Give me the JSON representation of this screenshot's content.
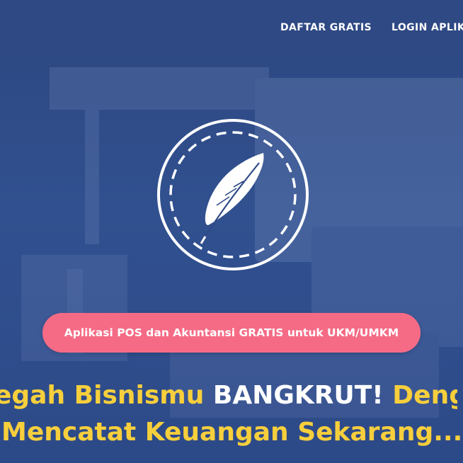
{
  "colors": {
    "background": "#2f4a86",
    "pill": "#f56b85",
    "accent_yellow": "#f7cf3c",
    "text_white": "#ffffff"
  },
  "nav": {
    "items": [
      {
        "label": "DAFTAR GRATIS"
      },
      {
        "label": "LOGIN APLIK"
      }
    ]
  },
  "logo": {
    "icon": "feather-icon"
  },
  "banner": {
    "label": "Aplikasi POS dan Akuntansi GRATIS untuk UKM/UMKM"
  },
  "headline": {
    "line1_part1": "egah Bisnismu ",
    "line1_part2": "BANGKRUT!",
    "line1_part3": " Denga",
    "line2": "Mencatat Keuangan Sekarang...."
  }
}
